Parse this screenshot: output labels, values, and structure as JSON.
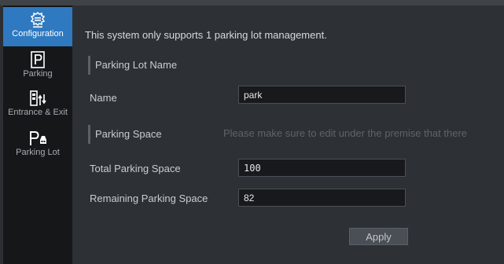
{
  "sidebar": {
    "items": [
      {
        "label": "Configuration",
        "icon": "gear-config-icon",
        "active": true
      },
      {
        "label": "Parking",
        "icon": "parking-p-icon",
        "active": false
      },
      {
        "label": "Entrance & Exit",
        "icon": "entrance-exit-icon",
        "active": false
      },
      {
        "label": "Parking Lot",
        "icon": "parking-lot-icon",
        "active": false
      }
    ]
  },
  "main": {
    "notice": "This system only supports 1 parking lot management.",
    "parking_lot_section": "Parking Lot Name",
    "name_label": "Name",
    "name_value": "park",
    "parking_space_section": "Parking Space",
    "parking_space_hint": "Please make sure to edit under the premise that there",
    "total_label": "Total Parking Space",
    "total_value": "100",
    "remaining_label": "Remaining Parking Space",
    "remaining_value": "82",
    "apply_label": "Apply"
  },
  "colors": {
    "accent": "#2f79c0",
    "sidebar_bg": "#151719",
    "content_bg": "#2d3035"
  }
}
